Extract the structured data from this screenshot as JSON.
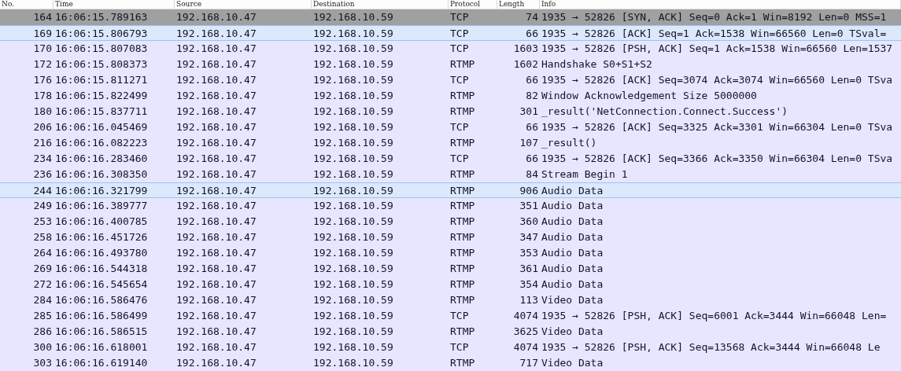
{
  "columns": [
    "No.",
    "Time",
    "Source",
    "Destination",
    "Protocol",
    "Length",
    "Info"
  ],
  "rows": [
    {
      "no": "164",
      "time": "16:06:15.789163",
      "source": "192.168.10.47",
      "destination": "192.168.10.59",
      "protocol": "TCP",
      "length": "74",
      "info": "1935 → 52826 [SYN, ACK] Seq=0 Ack=1 Win=8192 Len=0 MSS=1",
      "selected": true,
      "highlighted": false
    },
    {
      "no": "169",
      "time": "16:06:15.806793",
      "source": "192.168.10.47",
      "destination": "192.168.10.59",
      "protocol": "TCP",
      "length": "66",
      "info": "1935 → 52826 [ACK] Seq=1 Ack=1538 Win=66560 Len=0 TSval=",
      "selected": false,
      "highlighted": true
    },
    {
      "no": "170",
      "time": "16:06:15.807083",
      "source": "192.168.10.47",
      "destination": "192.168.10.59",
      "protocol": "TCP",
      "length": "1603",
      "info": "1935 → 52826 [PSH, ACK] Seq=1 Ack=1538 Win=66560 Len=1537",
      "selected": false,
      "highlighted": false
    },
    {
      "no": "172",
      "time": "16:06:15.808373",
      "source": "192.168.10.47",
      "destination": "192.168.10.59",
      "protocol": "RTMP",
      "length": "1602",
      "info": "Handshake S0+S1+S2",
      "selected": false,
      "highlighted": false
    },
    {
      "no": "176",
      "time": "16:06:15.811271",
      "source": "192.168.10.47",
      "destination": "192.168.10.59",
      "protocol": "TCP",
      "length": "66",
      "info": "1935 → 52826 [ACK] Seq=3074 Ack=3074 Win=66560 Len=0 TSva",
      "selected": false,
      "highlighted": false
    },
    {
      "no": "178",
      "time": "16:06:15.822499",
      "source": "192.168.10.47",
      "destination": "192.168.10.59",
      "protocol": "RTMP",
      "length": "82",
      "info": "Window Acknowledgement Size 5000000",
      "selected": false,
      "highlighted": false
    },
    {
      "no": "180",
      "time": "16:06:15.837711",
      "source": "192.168.10.47",
      "destination": "192.168.10.59",
      "protocol": "RTMP",
      "length": "301",
      "info": "_result('NetConnection.Connect.Success')",
      "selected": false,
      "highlighted": false
    },
    {
      "no": "206",
      "time": "16:06:16.045469",
      "source": "192.168.10.47",
      "destination": "192.168.10.59",
      "protocol": "TCP",
      "length": "66",
      "info": "1935 → 52826 [ACK] Seq=3325 Ack=3301 Win=66304 Len=0 TSva",
      "selected": false,
      "highlighted": false
    },
    {
      "no": "216",
      "time": "16:06:16.082223",
      "source": "192.168.10.47",
      "destination": "192.168.10.59",
      "protocol": "RTMP",
      "length": "107",
      "info": "_result()",
      "selected": false,
      "highlighted": false
    },
    {
      "no": "234",
      "time": "16:06:16.283460",
      "source": "192.168.10.47",
      "destination": "192.168.10.59",
      "protocol": "TCP",
      "length": "66",
      "info": "1935 → 52826 [ACK] Seq=3366 Ack=3350 Win=66304 Len=0 TSva",
      "selected": false,
      "highlighted": false
    },
    {
      "no": "236",
      "time": "16:06:16.308350",
      "source": "192.168.10.47",
      "destination": "192.168.10.59",
      "protocol": "RTMP",
      "length": "84",
      "info": "Stream Begin 1",
      "selected": false,
      "highlighted": false
    },
    {
      "no": "244",
      "time": "16:06:16.321799",
      "source": "192.168.10.47",
      "destination": "192.168.10.59",
      "protocol": "RTMP",
      "length": "906",
      "info": "Audio Data",
      "selected": false,
      "highlighted": true
    },
    {
      "no": "249",
      "time": "16:06:16.389777",
      "source": "192.168.10.47",
      "destination": "192.168.10.59",
      "protocol": "RTMP",
      "length": "351",
      "info": "Audio Data",
      "selected": false,
      "highlighted": false
    },
    {
      "no": "253",
      "time": "16:06:16.400785",
      "source": "192.168.10.47",
      "destination": "192.168.10.59",
      "protocol": "RTMP",
      "length": "360",
      "info": "Audio Data",
      "selected": false,
      "highlighted": false
    },
    {
      "no": "258",
      "time": "16:06:16.451726",
      "source": "192.168.10.47",
      "destination": "192.168.10.59",
      "protocol": "RTMP",
      "length": "347",
      "info": "Audio Data",
      "selected": false,
      "highlighted": false
    },
    {
      "no": "264",
      "time": "16:06:16.493780",
      "source": "192.168.10.47",
      "destination": "192.168.10.59",
      "protocol": "RTMP",
      "length": "353",
      "info": "Audio Data",
      "selected": false,
      "highlighted": false
    },
    {
      "no": "269",
      "time": "16:06:16.544318",
      "source": "192.168.10.47",
      "destination": "192.168.10.59",
      "protocol": "RTMP",
      "length": "361",
      "info": "Audio Data",
      "selected": false,
      "highlighted": false
    },
    {
      "no": "272",
      "time": "16:06:16.545654",
      "source": "192.168.10.47",
      "destination": "192.168.10.59",
      "protocol": "RTMP",
      "length": "354",
      "info": "Audio Data",
      "selected": false,
      "highlighted": false
    },
    {
      "no": "284",
      "time": "16:06:16.586476",
      "source": "192.168.10.47",
      "destination": "192.168.10.59",
      "protocol": "RTMP",
      "length": "113",
      "info": "Video Data",
      "selected": false,
      "highlighted": false
    },
    {
      "no": "285",
      "time": "16:06:16.586499",
      "source": "192.168.10.47",
      "destination": "192.168.10.59",
      "protocol": "TCP",
      "length": "4074",
      "info": "1935 → 52826 [PSH, ACK] Seq=6001 Ack=3444 Win=66048 Len=",
      "selected": false,
      "highlighted": false
    },
    {
      "no": "286",
      "time": "16:06:16.586515",
      "source": "192.168.10.47",
      "destination": "192.168.10.59",
      "protocol": "RTMP",
      "length": "3625",
      "info": "Video Data",
      "selected": false,
      "highlighted": false
    },
    {
      "no": "300",
      "time": "16:06:16.618001",
      "source": "192.168.10.47",
      "destination": "192.168.10.59",
      "protocol": "TCP",
      "length": "4074",
      "info": "1935 → 52826 [PSH, ACK] Seq=13568 Ack=3444 Win=66048 Le",
      "selected": false,
      "highlighted": false
    },
    {
      "no": "303",
      "time": "16:06:16.619140",
      "source": "192.168.10.47",
      "destination": "192.168.10.59",
      "protocol": "RTMP",
      "length": "717",
      "info": "Video Data",
      "selected": false,
      "highlighted": false
    }
  ]
}
